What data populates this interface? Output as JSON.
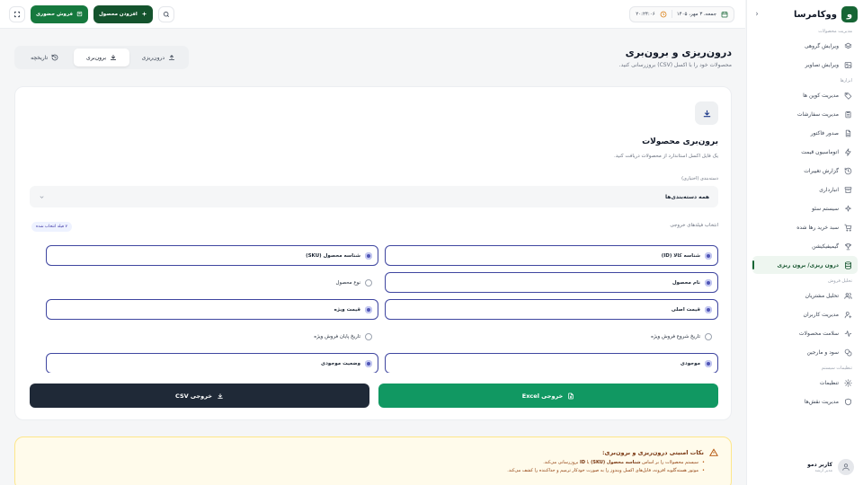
{
  "brand": {
    "logo_letter": "و",
    "name": "ووکامرسا"
  },
  "sidebar": {
    "sections": [
      {
        "label": "مدیریت محصولات",
        "items": [
          {
            "label": "ویرایش گروهی",
            "icon": "layers-icon",
            "active": false
          },
          {
            "label": "ویرایش تصاویر",
            "icon": "image-icon",
            "active": false
          }
        ]
      },
      {
        "label": "ابزارها",
        "items": [
          {
            "label": "مدیریت کوپن ها",
            "icon": "tag-icon",
            "active": false
          },
          {
            "label": "مدیریت سفارشات",
            "icon": "clipboard-icon",
            "active": false
          },
          {
            "label": "صدور فاکتور",
            "icon": "file-icon",
            "active": false
          },
          {
            "label": "اتوماسیون قیمت",
            "icon": "zap-icon",
            "active": false
          },
          {
            "label": "گزارش تغییرات",
            "icon": "history-icon",
            "active": false
          },
          {
            "label": "انبارداری",
            "icon": "archive-icon",
            "active": false
          },
          {
            "label": "سیستم سئو",
            "icon": "sparkles-icon",
            "active": false
          },
          {
            "label": "سبد خرید رها شده",
            "icon": "cart-icon",
            "active": false
          },
          {
            "label": "گیمیفیکیشن",
            "icon": "trophy-icon",
            "active": false
          },
          {
            "label": "درون ریزی/ برون ریزی",
            "icon": "database-icon",
            "active": true
          }
        ]
      },
      {
        "label": "تحلیل فروش",
        "items": [
          {
            "label": "تحلیل مشتریان",
            "icon": "users-icon",
            "active": false
          },
          {
            "label": "مدیریت کاربران",
            "icon": "user-cog-icon",
            "active": false
          },
          {
            "label": "سلامت محصولات",
            "icon": "activity-icon",
            "active": false
          },
          {
            "label": "سود و مارجین",
            "icon": "coins-icon",
            "active": false
          }
        ]
      },
      {
        "label": "تنظیمات سیستم",
        "items": [
          {
            "label": "تنظیمات",
            "icon": "gear-icon",
            "active": false
          },
          {
            "label": "مدیریت نقش‌ها",
            "icon": "shield-icon",
            "active": false
          }
        ]
      }
    ]
  },
  "user": {
    "name": "کاربر دمو",
    "role": "مدیر ارشد"
  },
  "topbar": {
    "date": "جمعه، ۳ مهر، ۱۴۰۵",
    "time": "۲۰:۲۴:۰۶",
    "add_product_label": "افزودن محصول",
    "pos_label": "فروش حضوری"
  },
  "page": {
    "title": "درون‌ریزی و برون‌بری",
    "subtitle": "محصولات خود را با اکسل (CSV) بروزرسانی کنید."
  },
  "tabs": [
    {
      "label": "درون‌ریزی",
      "icon": "upload-icon",
      "active": false
    },
    {
      "label": "برون‌بری",
      "icon": "download-icon",
      "active": true
    },
    {
      "label": "تاریخچه",
      "icon": "history-icon",
      "active": false
    }
  ],
  "export": {
    "title": "برون‌بری محصولات",
    "description": "یک فایل اکسل استاندارد از محصولات دریافت کنید.",
    "category_label": "دسته‌بندی (اختیاری)",
    "category_value": "همه دسته‌بندی‌ها",
    "fields_label": "انتخاب فیلدهای خروجی",
    "selected_badge": "۷ فیلد انتخاب شده",
    "fields": [
      {
        "label": "شناسه کالا (ID)",
        "checked": true
      },
      {
        "label": "شناسه محصول (SKU)",
        "checked": true
      },
      {
        "label": "نام محصول",
        "checked": true
      },
      {
        "label": "نوع محصول",
        "checked": false
      },
      {
        "label": "قیمت اصلی",
        "checked": true
      },
      {
        "label": "قیمت ویژه",
        "checked": true
      },
      {
        "label": "تاریخ شروع فروش ویژه",
        "checked": false
      },
      {
        "label": "تاریخ پایان فروش ویژه",
        "checked": false
      },
      {
        "label": "موجودی",
        "checked": true
      },
      {
        "label": "وضعیت موجودی",
        "checked": true
      }
    ],
    "excel_button": "خروجی Excel",
    "csv_button": "خروجی CSV"
  },
  "notes": {
    "title": "نکات امنیتی درون‌ریزی و برون‌بری:",
    "items": [
      {
        "pre": "سیستم محصولات را بر اساس ",
        "bold": "شناسه محصول (SKU)",
        "mid": " یا ",
        "bold2": "ID",
        "post": " بروزرسانی می‌کند."
      },
      {
        "pre": "موتور هسته‌گلوبه افزونه، فایل‌های اکسل ویندوز را به صورت خودکار ترمیم و جداکننده را کشف می‌کند.",
        "bold": "",
        "mid": "",
        "bold2": "",
        "post": ""
      }
    ]
  },
  "colors": {
    "brand_green": "#166534",
    "excel_green": "#119862",
    "csv_dark": "#1f2937",
    "checked_indigo": "#4f55b5"
  }
}
